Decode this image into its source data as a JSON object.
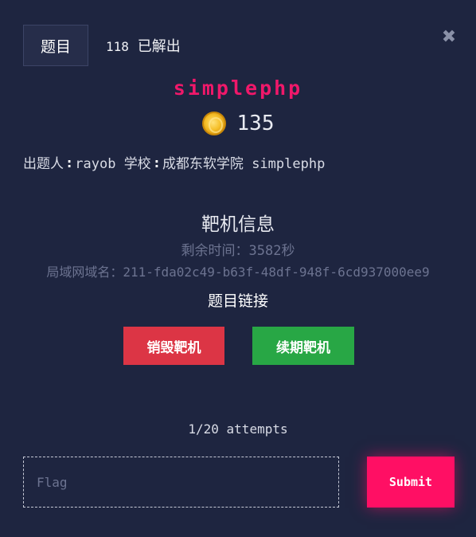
{
  "header": {
    "tab_label": "题目",
    "solved_count": "118",
    "solved_label": "已解出",
    "close_glyph": "✖"
  },
  "challenge": {
    "title": "simplephp",
    "points": "135",
    "author_label": "出题人",
    "author": "rayob",
    "school_label": "学校",
    "school": "成都东软学院",
    "category": "simplephp",
    "separator": "∶"
  },
  "target": {
    "section_title": "靶机信息",
    "remaining_label": "剩余时间：",
    "remaining_value": "3582秒",
    "domain_label": "局域网域名：",
    "domain_value": "211-fda02c49-b63f-48df-948f-6cd937000ee9",
    "link_label": "题目链接",
    "destroy_label": "销毁靶机",
    "renew_label": "续期靶机"
  },
  "submission": {
    "attempts": "1/20 attempts",
    "flag_placeholder": "Flag",
    "submit_label": "Submit"
  },
  "colors": {
    "background": "#1e2540",
    "title_accent": "#f0186a",
    "destroy": "#dc3545",
    "renew": "#28a745",
    "submit": "#ff0f64"
  },
  "icons": {
    "close": "close-icon",
    "points": "coin-icon"
  }
}
